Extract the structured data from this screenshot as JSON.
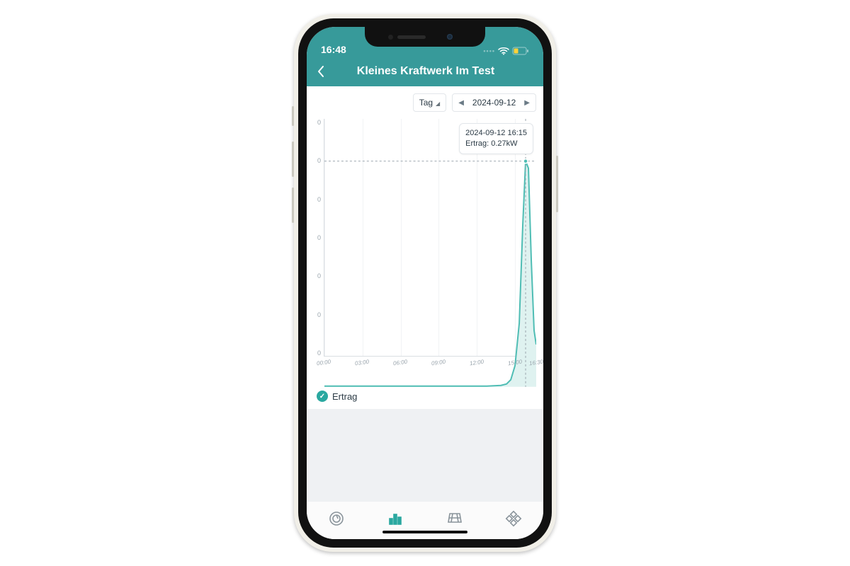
{
  "status": {
    "time": "16:48"
  },
  "header": {
    "title": "Kleines Kraftwerk Im Test"
  },
  "toolbar": {
    "range_label": "Tag",
    "date": "2024-09-12"
  },
  "tooltip": {
    "line1": "2024-09-12 16:15",
    "line2": "Ertrag: 0.27kW"
  },
  "legend": {
    "series": "Ertrag"
  },
  "chart_data": {
    "type": "line",
    "title": "",
    "xlabel": "",
    "ylabel": "",
    "ylim": [
      0,
      0.32
    ],
    "y_ticks": [
      "0",
      "0",
      "0",
      "0",
      "0",
      "0",
      "0"
    ],
    "x_ticks": [
      "00:00",
      "03:00",
      "06:00",
      "09:00",
      "12:00",
      "15:00",
      "16:30"
    ],
    "series": [
      {
        "name": "Ertrag",
        "color": "#4fbdb4",
        "x": [
          "00:00",
          "03:00",
          "06:00",
          "09:00",
          "12:00",
          "14:00",
          "15:00",
          "15:30",
          "15:45",
          "16:00",
          "16:15",
          "16:30"
        ],
        "values": [
          0,
          0,
          0,
          0,
          0,
          0,
          0.005,
          0.01,
          0.05,
          0.12,
          0.27,
          0.08
        ]
      }
    ],
    "marker": {
      "x": "16:15",
      "y": 0.27
    }
  },
  "colors": {
    "accent": "#379a9a",
    "series": "#4fbdb4"
  }
}
